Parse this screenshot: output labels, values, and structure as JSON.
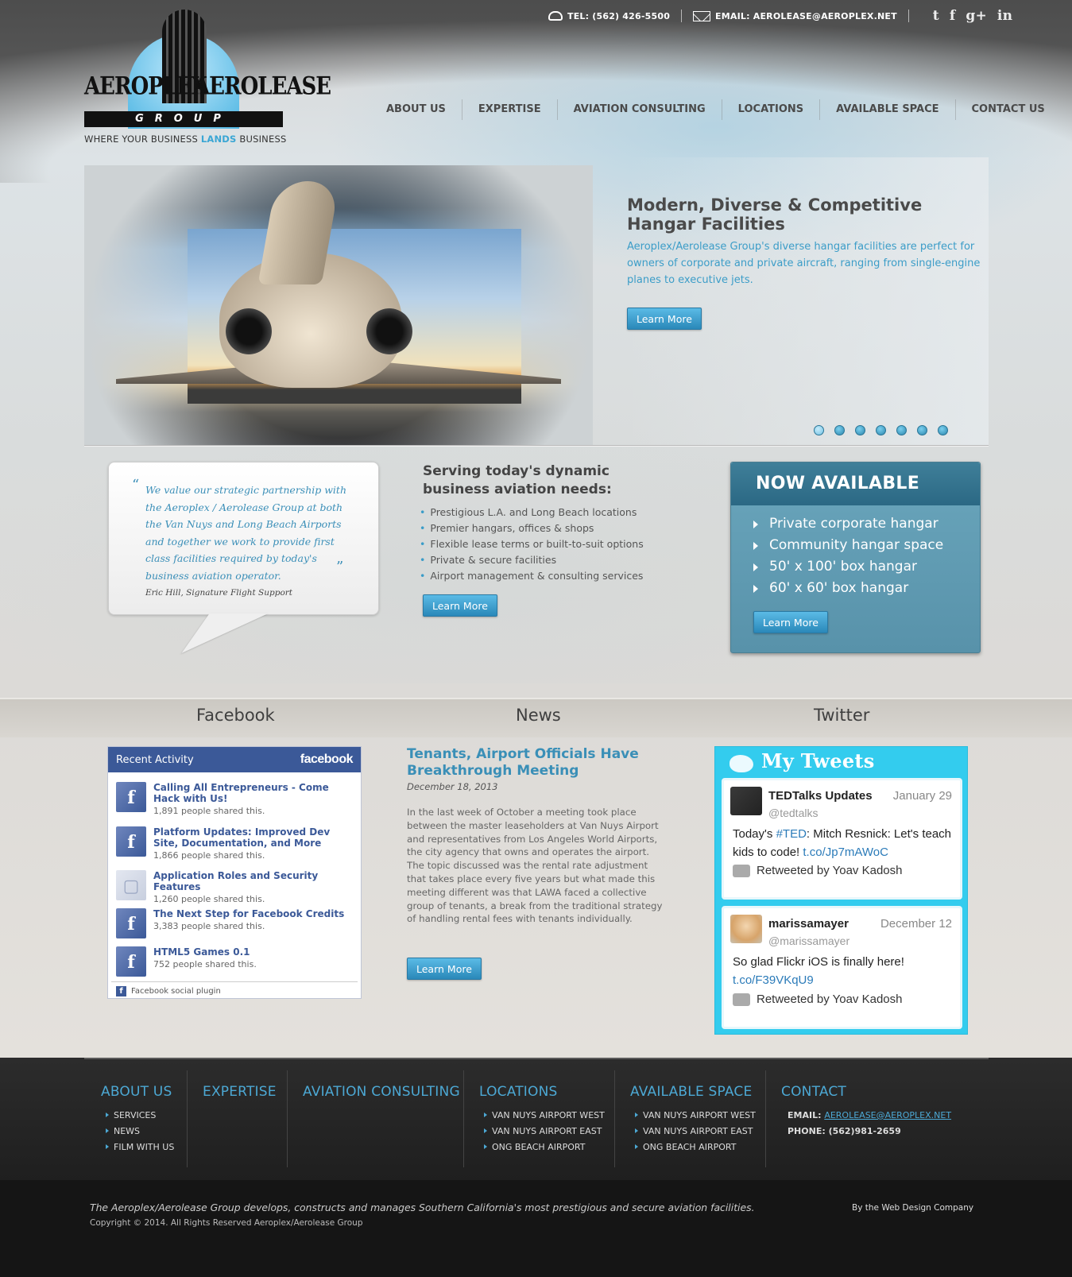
{
  "topbar": {
    "phone": "TEL: (562) 426-5500",
    "email": "EMAIL: AEROLEASE@AEROPLEX.NET",
    "social": [
      {
        "name": "twitter",
        "glyph": "t"
      },
      {
        "name": "facebook",
        "glyph": "f"
      },
      {
        "name": "google-plus",
        "glyph": "g+"
      },
      {
        "name": "linkedin",
        "glyph": "in"
      }
    ]
  },
  "logo": {
    "left_word": "AEROPLEX",
    "right_word": "AEROLEASE",
    "group": "GROUP",
    "tagline_pre": "WHERE YOUR BUSINESS ",
    "tagline_em": "LANDS",
    "tagline_post": " BUSINESS"
  },
  "nav": [
    "ABOUT US",
    "EXPERTISE",
    "AVIATION CONSULTING",
    "LOCATIONS",
    "AVAILABLE SPACE",
    "CONTACT US"
  ],
  "hero": {
    "title": "Modern, Diverse & Competitive Hangar Facilities",
    "text": "Aeroplex/Aerolease Group's diverse hangar facilities are perfect for owners of corporate and private aircraft, ranging from single-engine planes to executive jets.",
    "button": "Learn More",
    "slides": 7,
    "active_slide": 1
  },
  "quote": {
    "text": "We value our strategic partnership with the Aeroplex / Aerolease Group at both the Van Nuys and Long Beach Airports and together we work to provide first class facilities required by today's business aviation operator.",
    "author": "Eric Hill, Signature Flight Support",
    "open_mark": "“",
    "close_mark": "”"
  },
  "serving": {
    "title": "Serving today's dynamic business aviation needs:",
    "items": [
      "Prestigious L.A. and Long Beach locations",
      "Premier hangars, offices & shops",
      "Flexible lease terms or built-to-suit options",
      "Private & secure facilities",
      "Airport management & consulting services"
    ],
    "button": "Learn More"
  },
  "available": {
    "title": "NOW AVAILABLE",
    "items": [
      "Private corporate hangar",
      "Community hangar space",
      "50' x 100' box hangar",
      "60' x 60' box hangar"
    ],
    "button": "Learn More"
  },
  "band": {
    "facebook": "Facebook",
    "news": "News",
    "twitter": "Twitter"
  },
  "facebook": {
    "header": "Recent Activity",
    "brand": "facebook",
    "items": [
      {
        "title": "Calling All Entrepreneurs - Come Hack with Us!",
        "shares": "1,891 people shared this."
      },
      {
        "title": "Platform Updates: Improved Dev Site, Documentation, and More",
        "shares": "1,866 people shared this."
      },
      {
        "title": "Application Roles and Security Features",
        "shares": "1,260 people shared this."
      },
      {
        "title": "The Next Step for Facebook Credits",
        "shares": "3,383 people shared this."
      },
      {
        "title": "HTML5 Games 0.1",
        "shares": "752 people shared this."
      }
    ],
    "footer": "Facebook social plugin"
  },
  "news": {
    "title": "Tenants, Airport Officials Have Breakthrough Meeting",
    "date": "December 18, 2013",
    "body": "In the last week of October a meeting took place between the master leaseholders at Van Nuys Airport and representatives from Los Angeles World Airports, the city agency that owns and operates the airport. The topic discussed was the rental rate adjustment that takes place every five years but what made this meeting different was that LAWA faced a collective group of tenants, a break from the traditional strategy of handling rental fees with tenants individually.",
    "button": "Learn More"
  },
  "twitter": {
    "title": "My Tweets",
    "tweets": [
      {
        "name": "TEDTalks Updates",
        "handle": "@tedtalks",
        "date": "January 29",
        "text_pre": "Today's ",
        "hashtag": "#TED",
        "text_mid": ": Mitch Resnick: Let's teach kids to code! ",
        "link": "t.co/Jp7mAWoC",
        "retweet": "Retweeted by Yoav Kadosh"
      },
      {
        "name": "marissamayer",
        "handle": "@marissamayer",
        "date": "December 12",
        "text_pre": "So glad Flickr iOS is finally here! ",
        "link": "t.co/F39VKqU9",
        "retweet": "Retweeted by Yoav Kadosh"
      }
    ]
  },
  "footer": {
    "cols": [
      {
        "title": "ABOUT US",
        "links": [
          "SERVICES",
          "NEWS",
          "FILM WITH US"
        ]
      },
      {
        "title": "EXPERTISE",
        "links": []
      },
      {
        "title": "AVIATION CONSULTING",
        "links": []
      },
      {
        "title": "LOCATIONS",
        "links": [
          "VAN NUYS AIRPORT WEST",
          "VAN NUYS AIRPORT EAST",
          "ONG BEACH AIRPORT"
        ]
      },
      {
        "title": "AVAILABLE SPACE",
        "links": [
          "VAN NUYS AIRPORT WEST",
          "VAN NUYS AIRPORT EAST",
          "ONG BEACH AIRPORT"
        ]
      },
      {
        "title": "CONTACT",
        "links": []
      }
    ],
    "contact_email_label": "EMAIL: ",
    "contact_email": "AEROLEASE@AEROPLEX.NET",
    "contact_phone": "PHONE: (562)981-2659",
    "description": "The Aeroplex/Aerolease Group develops, constructs and manages Southern California's most prestigious and secure aviation facilities.",
    "copyright": "Copyright © 2014. All Rights Reserved Aeroplex/Aerolease Group",
    "by": "By the Web Design Company"
  },
  "colors": {
    "accent": "#3a9cc8",
    "facebook": "#3b5998",
    "twitter_bg": "#33ccee",
    "available_bg": "#5a94ab",
    "footer_bg": "#222222"
  }
}
